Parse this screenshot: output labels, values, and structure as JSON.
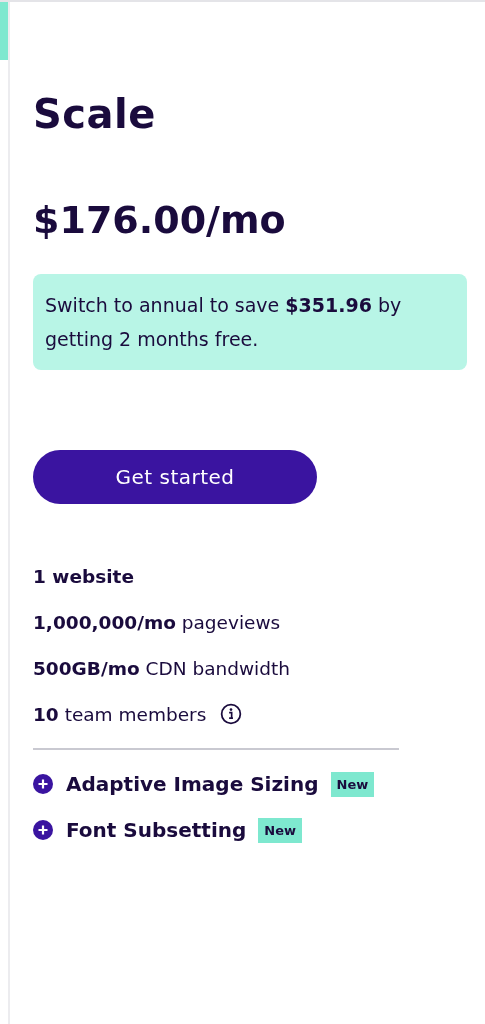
{
  "plan": {
    "name": "Scale",
    "price": "$176.00/mo"
  },
  "promo": {
    "text": "Switch to annual to save **$351.96** by getting 2 months free."
  },
  "cta": {
    "label": "Get started"
  },
  "features": [
    {
      "text": "1 website",
      "bold": true,
      "info": false
    },
    {
      "text": "**1,000,000/mo** pageviews",
      "bold": false,
      "info": false
    },
    {
      "text": "**500GB/mo** CDN bandwidth",
      "bold": false,
      "info": false
    },
    {
      "text": "**10** team members",
      "bold": false,
      "info": true
    }
  ],
  "addons": [
    {
      "name": "Adaptive Image Sizing",
      "badge": "New"
    },
    {
      "name": "Font Subsetting",
      "badge": "New"
    }
  ]
}
